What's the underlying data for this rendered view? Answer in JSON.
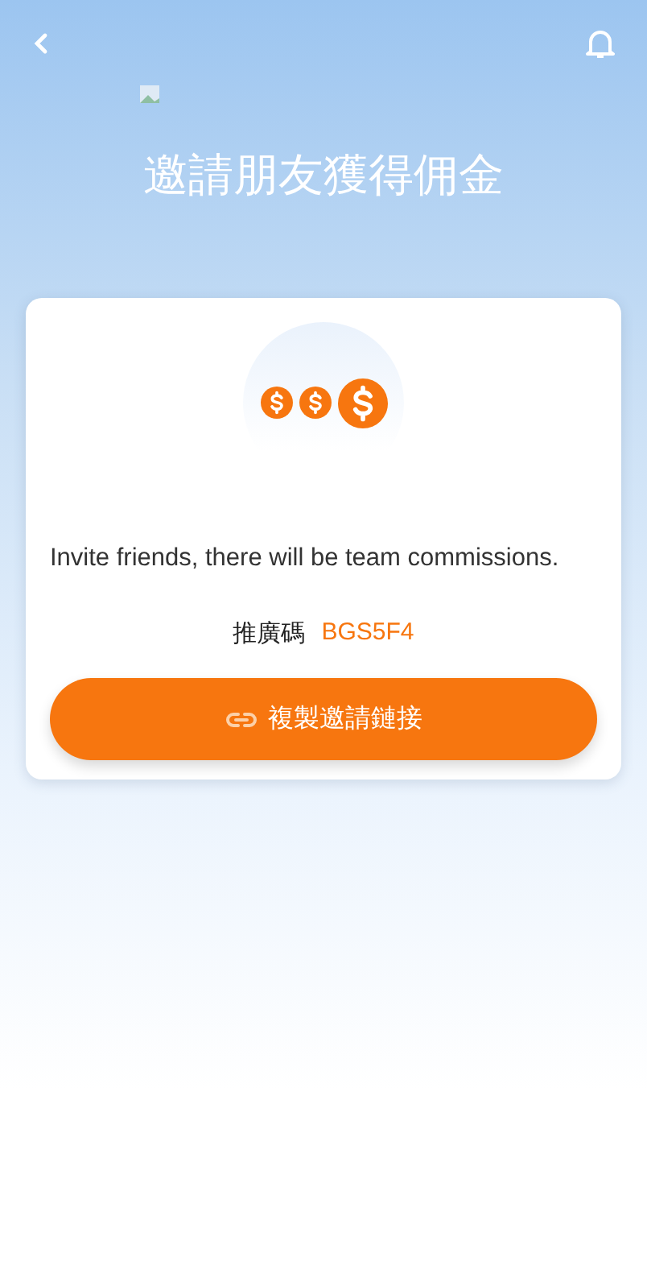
{
  "header": {
    "title": "邀請朋友獲得佣金"
  },
  "card": {
    "message": "Invite friends, there will be team commissions.",
    "code_label": "推廣碼",
    "code": "BGS5F4",
    "button": "複製邀請鏈接"
  }
}
